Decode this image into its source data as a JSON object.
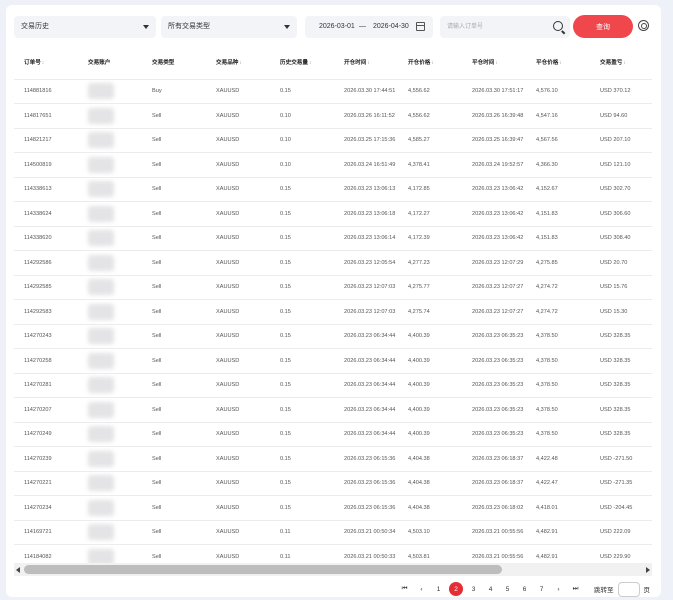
{
  "filters": {
    "history_select": "交易历史",
    "type_select": "所有交易类型",
    "date_from": "2026-03-01",
    "date_sep": "—",
    "date_to": "2026-04-30",
    "search_placeholder": "请输入订单号",
    "query_button": "查询"
  },
  "table": {
    "columns": [
      "订单号",
      "交易账户",
      "交易类型",
      "交易品种",
      "历史交易量",
      "开仓时间",
      "开仓价格",
      "平仓时间",
      "平仓价格",
      "交易盈亏"
    ],
    "rows": [
      [
        "114881816",
        "",
        "Buy",
        "XAUUSD",
        "0.15",
        "2026.03.30 17:44:51",
        "4,556.62",
        "2026.03.30 17:51:17",
        "4,576.10",
        "USD 370.12"
      ],
      [
        "114817651",
        "",
        "Sell",
        "XAUUSD",
        "0.10",
        "2026.03.26 16:11:52",
        "4,556.62",
        "2026.03.26 16:39:48",
        "4,547.16",
        "USD 94.60"
      ],
      [
        "114821217",
        "",
        "Sell",
        "XAUUSD",
        "0.10",
        "2026.03.25 17:15:36",
        "4,585.27",
        "2026.03.25 16:39:47",
        "4,567.56",
        "USD 207.10"
      ],
      [
        "114500819",
        "",
        "Sell",
        "XAUUSD",
        "0.10",
        "2026.03.24 16:51:49",
        "4,378.41",
        "2026.03.24 19:52:57",
        "4,366.30",
        "USD 121.10"
      ],
      [
        "114338613",
        "",
        "Sell",
        "XAUUSD",
        "0.15",
        "2026.03.23 13:06:13",
        "4,172.85",
        "2026.03.23 13:06:42",
        "4,152.67",
        "USD 302.70"
      ],
      [
        "114338624",
        "",
        "Sell",
        "XAUUSD",
        "0.15",
        "2026.03.23 13:06:18",
        "4,172.27",
        "2026.03.23 13:06:42",
        "4,151.83",
        "USD 306.60"
      ],
      [
        "114338620",
        "",
        "Sell",
        "XAUUSD",
        "0.15",
        "2026.03.23 13:06:14",
        "4,172.39",
        "2026.03.23 13:06:42",
        "4,151.83",
        "USD 308.40"
      ],
      [
        "114292586",
        "",
        "Sell",
        "XAUUSD",
        "0.15",
        "2026.03.23 12:05:54",
        "4,277.23",
        "2026.03.23 12:07:29",
        "4,275.85",
        "USD 20.70"
      ],
      [
        "114292585",
        "",
        "Sell",
        "XAUUSD",
        "0.15",
        "2026.03.23 12:07:03",
        "4,275.77",
        "2026.03.23 12:07:27",
        "4,274.72",
        "USD 15.76"
      ],
      [
        "114292583",
        "",
        "Sell",
        "XAUUSD",
        "0.15",
        "2026.03.23 12:07:03",
        "4,275.74",
        "2026.03.23 12:07:27",
        "4,274.72",
        "USD 15.30"
      ],
      [
        "114270243",
        "",
        "Sell",
        "XAUUSD",
        "0.15",
        "2026.03.23 06:34:44",
        "4,400.39",
        "2026.03.23 06:35:23",
        "4,378.50",
        "USD 328.35"
      ],
      [
        "114270258",
        "",
        "Sell",
        "XAUUSD",
        "0.15",
        "2026.03.23 06:34:44",
        "4,400.39",
        "2026.03.23 06:35:23",
        "4,378.50",
        "USD 328.35"
      ],
      [
        "114270281",
        "",
        "Sell",
        "XAUUSD",
        "0.15",
        "2026.03.23 06:34:44",
        "4,400.39",
        "2026.03.23 06:35:23",
        "4,378.50",
        "USD 328.35"
      ],
      [
        "114270207",
        "",
        "Sell",
        "XAUUSD",
        "0.15",
        "2026.03.23 06:34:44",
        "4,400.39",
        "2026.03.23 06:35:23",
        "4,378.50",
        "USD 328.35"
      ],
      [
        "114270249",
        "",
        "Sell",
        "XAUUSD",
        "0.15",
        "2026.03.23 06:34:44",
        "4,400.39",
        "2026.03.23 06:35:23",
        "4,378.50",
        "USD 328.35"
      ],
      [
        "114270239",
        "",
        "Sell",
        "XAUUSD",
        "0.15",
        "2026.03.23 06:15:36",
        "4,404.38",
        "2026.03.23 06:18:37",
        "4,422.48",
        "USD -271.50"
      ],
      [
        "114270221",
        "",
        "Sell",
        "XAUUSD",
        "0.15",
        "2026.03.23 06:15:36",
        "4,404.38",
        "2026.03.23 06:18:37",
        "4,422.47",
        "USD -271.35"
      ],
      [
        "114270234",
        "",
        "Sell",
        "XAUUSD",
        "0.15",
        "2026.03.23 06:15:36",
        "4,404.38",
        "2026.03.23 06:18:02",
        "4,418.01",
        "USD -204.45"
      ],
      [
        "114169721",
        "",
        "Sell",
        "XAUUSD",
        "0.11",
        "2026.03.21 00:50:34",
        "4,503.10",
        "2026.03.21 00:55:56",
        "4,482.91",
        "USD 222.09"
      ],
      [
        "114184082",
        "",
        "Sell",
        "XAUUSD",
        "0.11",
        "2026.03.21 00:50:33",
        "4,503.81",
        "2026.03.21 00:55:56",
        "4,482.91",
        "USD 229.90"
      ]
    ]
  },
  "pagination": {
    "first": "⏮",
    "prev": "‹",
    "pages": [
      "1",
      "2",
      "3",
      "4",
      "5",
      "6",
      "7"
    ],
    "current_page": "2",
    "next": "›",
    "last": "⏭",
    "goto_label": "跳转至",
    "goto_suffix": "页"
  },
  "colors": {
    "accent": "#e52d35",
    "query_button": "#f0474c"
  },
  "icons": {
    "search": "search-icon",
    "calendar": "calendar-icon",
    "settings": "gear-icon"
  }
}
